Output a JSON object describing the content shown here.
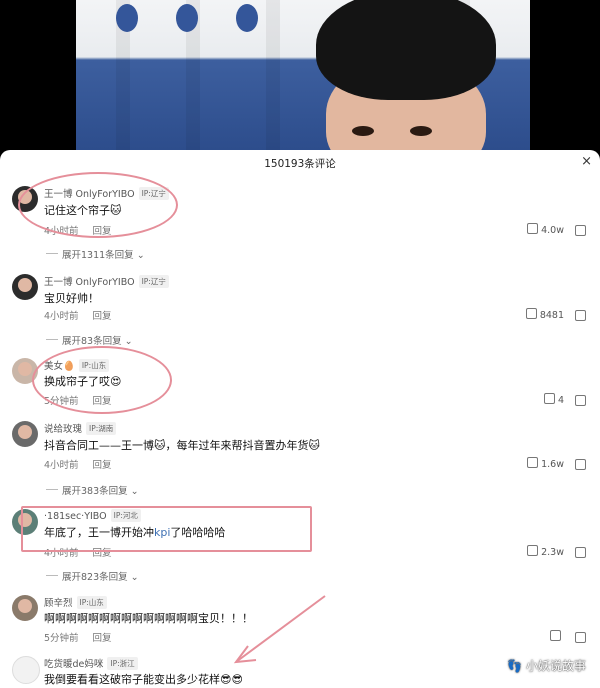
{
  "header": {
    "title": "150193条评论",
    "close": "×"
  },
  "comments": [
    {
      "name": "王一博 OnlyForYIBO",
      "ip": "IP:辽宁",
      "text": "记住这个帘子🐱",
      "time": "4小时前",
      "reply": "回复",
      "likes": "4.0w",
      "expand": "展开1311条回复"
    },
    {
      "name": "王一博 OnlyForYIBO",
      "ip": "IP:辽宁",
      "text": "宝贝好帅！",
      "time": "4小时前",
      "reply": "回复",
      "likes": "8481",
      "expand": "展开83条回复"
    },
    {
      "name": "美女🥚",
      "ip": "IP:山东",
      "text": "换成帘子了哎😍",
      "time": "5分钟前",
      "reply": "回复",
      "likes": "4"
    },
    {
      "name": "说给玫瑰",
      "ip": "IP:湖南",
      "text": "抖音合同工——王一博🐱，每年过年来帮抖音置办年货🐱",
      "time": "4小时前",
      "reply": "回复",
      "likes": "1.6w",
      "expand": "展开383条回复"
    },
    {
      "name": "·181sec·YIBO",
      "ip": "IP:河北",
      "text_a": "年底了，王一博开始冲",
      "text_kpi": "kpi",
      "text_b": "了哈哈哈哈",
      "time": "4小时前",
      "reply": "回复",
      "likes": "2.3w",
      "expand": "展开823条回复"
    },
    {
      "name": "顾辛烈",
      "ip": "IP:山东",
      "text": "啊啊啊啊啊啊啊啊啊啊啊啊啊啊宝贝！！！",
      "time": "5分钟前",
      "reply": "回复"
    },
    {
      "name": "吃货暖de妈咪",
      "ip": "IP:浙江",
      "text": "我倒要看看这破帘子能变出多少花样😎😎"
    }
  ],
  "watermark": "小妖说故事"
}
